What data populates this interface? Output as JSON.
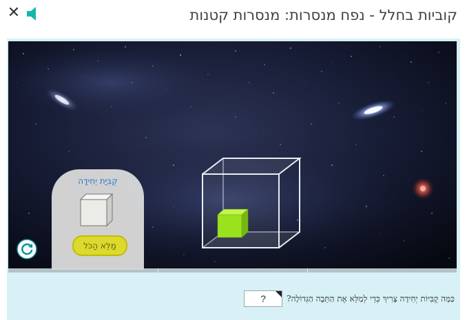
{
  "header": {
    "title": "קוביות בחלל  -  נפח מנסרות: מנסרות קטנות",
    "close_icon": "close-icon",
    "sound_icon": "speaker-icon",
    "sound_color": "#14b8a6"
  },
  "unit_panel": {
    "title": "קֻבִּיַּת יְחִידָה",
    "fill_button_label": "מַלֵּא הַכֹּל"
  },
  "reset_icon": "refresh-icon",
  "question": {
    "text": "כַּמָּה קֻבִּיּוֹת יְחִידָה צָרִיךְ כְּדֵי לְמַלֵּא אֶת הַתֵּבָה הַגְּדוֹלָה?",
    "answer_placeholder": "?"
  },
  "colors": {
    "frame_background": "#d7f1f6",
    "small_cube": "#9be21e",
    "fill_button": "#e5e230",
    "unit_title": "#2a7bd0"
  }
}
